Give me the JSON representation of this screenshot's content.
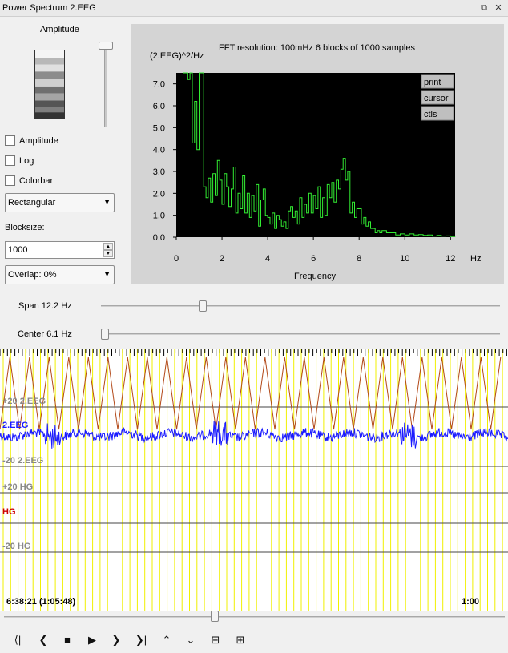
{
  "window": {
    "title": "Power Spectrum 2.EEG"
  },
  "sidebar": {
    "amplitude_label": "Amplitude",
    "checkboxes": [
      {
        "label": "Amplitude",
        "checked": false
      },
      {
        "label": "Log",
        "checked": false
      },
      {
        "label": "Colorbar",
        "checked": false
      }
    ],
    "window_select": {
      "value": "Rectangular"
    },
    "blocksize_label": "Blocksize:",
    "blocksize_value": "1000",
    "overlap_select": {
      "value": "Overlap: 0%"
    }
  },
  "spectrum": {
    "header": "FFT resolution: 100mHz   6 blocks of 1000 samples",
    "ylabel": "(2.EEG)^2/Hz",
    "xlabel": "Frequency",
    "xunit": "Hz",
    "buttons": [
      "print",
      "cursor",
      "ctls"
    ],
    "colors": {
      "background": "#000000",
      "line": "#33ee33",
      "frame": "#d4d4d4"
    }
  },
  "chart_data": {
    "type": "line",
    "title": "FFT resolution: 100mHz   6 blocks of 1000 samples",
    "xlabel": "Frequency",
    "ylabel": "(2.EEG)^2/Hz",
    "xlim": [
      0,
      12.2
    ],
    "ylim": [
      0,
      7.5
    ],
    "xticks": [
      "0",
      "2",
      "4",
      "6",
      "8",
      "10",
      "12"
    ],
    "yticks": [
      "0.0",
      "1.0",
      "2.0",
      "3.0",
      "4.0",
      "5.0",
      "6.0",
      "7.0"
    ],
    "grid": false,
    "series": [
      {
        "values": [
          [
            0.3,
            7.5
          ],
          [
            0.4,
            7.5
          ],
          [
            0.5,
            7.2
          ],
          [
            0.6,
            7.5
          ],
          [
            0.7,
            4.3
          ],
          [
            0.8,
            6.2
          ],
          [
            0.9,
            4.0
          ],
          [
            1.0,
            7.5
          ],
          [
            1.1,
            7.5
          ],
          [
            1.2,
            2.3
          ],
          [
            1.3,
            1.8
          ],
          [
            1.4,
            2.7
          ],
          [
            1.5,
            1.6
          ],
          [
            1.6,
            2.9
          ],
          [
            1.7,
            1.9
          ],
          [
            1.8,
            3.5
          ],
          [
            1.9,
            2.6
          ],
          [
            2.0,
            1.5
          ],
          [
            2.1,
            2.9
          ],
          [
            2.2,
            2.3
          ],
          [
            2.3,
            1.4
          ],
          [
            2.4,
            2.2
          ],
          [
            2.5,
            3.2
          ],
          [
            2.6,
            1.1
          ],
          [
            2.7,
            2.0
          ],
          [
            2.8,
            1.3
          ],
          [
            2.9,
            2.8
          ],
          [
            3.0,
            1.1
          ],
          [
            3.1,
            2.0
          ],
          [
            3.2,
            0.9
          ],
          [
            3.3,
            1.9
          ],
          [
            3.4,
            1.2
          ],
          [
            3.5,
            2.4
          ],
          [
            3.6,
            0.5
          ],
          [
            3.7,
            1.7
          ],
          [
            3.8,
            2.2
          ],
          [
            3.9,
            1.0
          ],
          [
            4.0,
            0.9
          ],
          [
            4.1,
            0.6
          ],
          [
            4.2,
            1.1
          ],
          [
            4.3,
            0.4
          ],
          [
            4.4,
            1.0
          ],
          [
            4.5,
            0.8
          ],
          [
            4.6,
            0.5
          ],
          [
            4.7,
            0.7
          ],
          [
            4.8,
            0.4
          ],
          [
            4.9,
            1.2
          ],
          [
            5.0,
            1.4
          ],
          [
            5.1,
            0.9
          ],
          [
            5.2,
            1.2
          ],
          [
            5.3,
            0.6
          ],
          [
            5.4,
            1.8
          ],
          [
            5.5,
            0.9
          ],
          [
            5.6,
            1.5
          ],
          [
            5.7,
            1.1
          ],
          [
            5.8,
            2.0
          ],
          [
            5.9,
            1.1
          ],
          [
            6.0,
            1.9
          ],
          [
            6.1,
            1.3
          ],
          [
            6.2,
            2.3
          ],
          [
            6.3,
            0.9
          ],
          [
            6.4,
            1.8
          ],
          [
            6.5,
            1.0
          ],
          [
            6.6,
            2.4
          ],
          [
            6.7,
            1.8
          ],
          [
            6.8,
            2.5
          ],
          [
            6.9,
            1.6
          ],
          [
            7.0,
            2.6
          ],
          [
            7.1,
            2.2
          ],
          [
            7.2,
            3.1
          ],
          [
            7.3,
            3.6
          ],
          [
            7.4,
            2.6
          ],
          [
            7.5,
            3.0
          ],
          [
            7.6,
            1.1
          ],
          [
            7.7,
            1.6
          ],
          [
            7.8,
            0.9
          ],
          [
            7.9,
            1.3
          ],
          [
            8.0,
            1.3
          ],
          [
            8.1,
            0.6
          ],
          [
            8.2,
            0.9
          ],
          [
            8.3,
            0.5
          ],
          [
            8.4,
            0.7
          ],
          [
            8.5,
            0.4
          ],
          [
            8.6,
            0.4
          ],
          [
            8.7,
            0.2
          ],
          [
            8.8,
            0.3
          ],
          [
            8.9,
            0.2
          ],
          [
            9.0,
            0.3
          ],
          [
            9.2,
            0.2
          ],
          [
            9.4,
            0.2
          ],
          [
            9.6,
            0.1
          ],
          [
            9.8,
            0.15
          ],
          [
            10.0,
            0.1
          ],
          [
            10.2,
            0.15
          ],
          [
            10.4,
            0.1
          ],
          [
            10.6,
            0.12
          ],
          [
            10.8,
            0.08
          ],
          [
            11.0,
            0.1
          ],
          [
            11.2,
            0.05
          ],
          [
            11.4,
            0.08
          ],
          [
            11.6,
            0.05
          ],
          [
            11.8,
            0.06
          ],
          [
            12.0,
            0.03
          ],
          [
            12.2,
            0.02
          ]
        ]
      }
    ]
  },
  "controls": {
    "span_label": "Span 12.2 Hz",
    "span_fraction": 0.25,
    "center_label": "Center 6.1 Hz",
    "center_fraction": 0.0
  },
  "eeg": {
    "channels": [
      {
        "upper": "+20 2.EEG",
        "name": "2.EEG",
        "lower": "-20 2.EEG",
        "color": "#1a1aff"
      },
      {
        "upper": "+20 HG",
        "name": "HG",
        "lower": "-20 HG",
        "color": "#cc0000"
      }
    ],
    "gridline_color": "#f0f000",
    "overlay_color": "#b34a1a",
    "time_left": "6:38:21 (1:05:48)",
    "time_right": "1:00",
    "scroll_fraction": 0.42
  },
  "toolbar": {
    "buttons": [
      {
        "name": "first-page",
        "glyph": "⟨|"
      },
      {
        "name": "prev",
        "glyph": "❮"
      },
      {
        "name": "stop",
        "glyph": "■"
      },
      {
        "name": "play",
        "glyph": "▶"
      },
      {
        "name": "next",
        "glyph": "❯"
      },
      {
        "name": "last-page",
        "glyph": "❯|"
      },
      {
        "name": "up",
        "glyph": "⌃"
      },
      {
        "name": "down",
        "glyph": "⌄"
      },
      {
        "name": "zoom-out",
        "glyph": "⊟"
      },
      {
        "name": "zoom-in",
        "glyph": "⊞"
      }
    ]
  }
}
